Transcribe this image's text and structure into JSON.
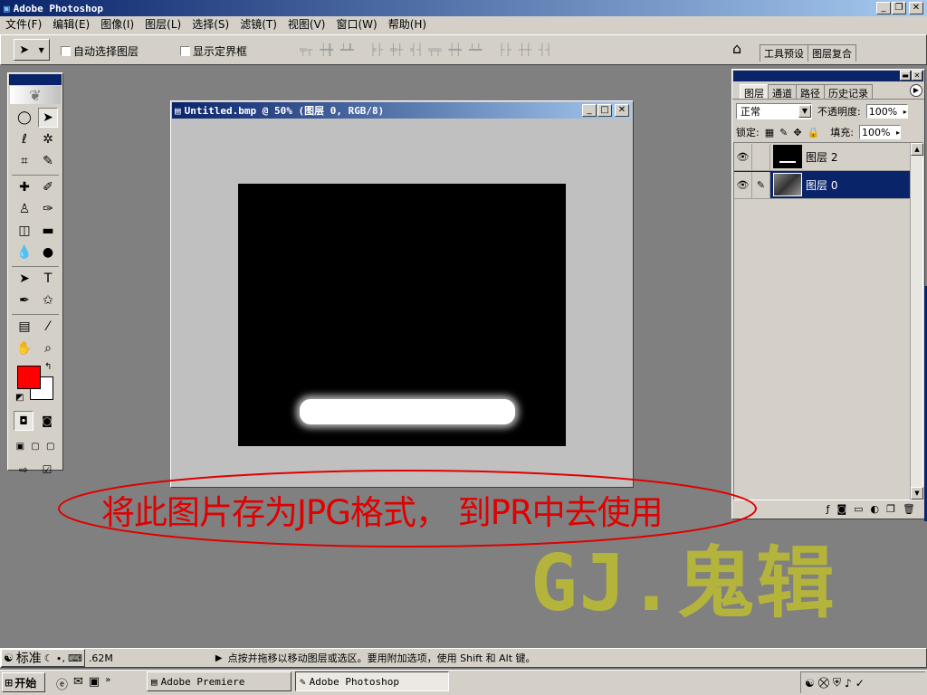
{
  "app": {
    "title": "Adobe Photoshop",
    "menu": [
      "文件(F)",
      "编辑(E)",
      "图像(I)",
      "图层(L)",
      "选择(S)",
      "滤镜(T)",
      "视图(V)",
      "窗口(W)",
      "帮助(H)"
    ]
  },
  "options_bar": {
    "auto_select_label": "自动选择图层",
    "show_bounds_label": "显示定界框",
    "tab_tool_presets": "工具预设",
    "tab_layer_comps": "图层复合"
  },
  "document": {
    "title": "Untitled.bmp @ 50% (图层 0, RGB/8)"
  },
  "layers_panel": {
    "tabs": [
      "图层",
      "通道",
      "路径",
      "历史记录"
    ],
    "blend_mode": "正常",
    "opacity_label": "不透明度:",
    "opacity_value": "100%",
    "lock_label": "锁定:",
    "fill_label": "填充:",
    "fill_value": "100%",
    "layers": [
      {
        "name": "图层 2",
        "selected": false
      },
      {
        "name": "图层 0",
        "selected": true
      }
    ]
  },
  "overlay": {
    "annotation": "将此图片存为JPG格式， 到PR中去使用",
    "watermark": "GJ.鬼辑"
  },
  "ime": {
    "mode": "标准"
  },
  "status_bar": {
    "doc_size": ".62M",
    "hint": "点按并拖移以移动图层或选区。要用附加选项，使用 Shift 和 Alt 键。"
  },
  "taskbar": {
    "start": "开始",
    "tasks": [
      "Adobe Premiere",
      "Adobe Photoshop"
    ]
  },
  "colors": {
    "foreground": "#ff0000",
    "background": "#ffffff",
    "annotation": "#e00000",
    "watermark": "#b4b43c",
    "titlebar": "#0a246a"
  }
}
